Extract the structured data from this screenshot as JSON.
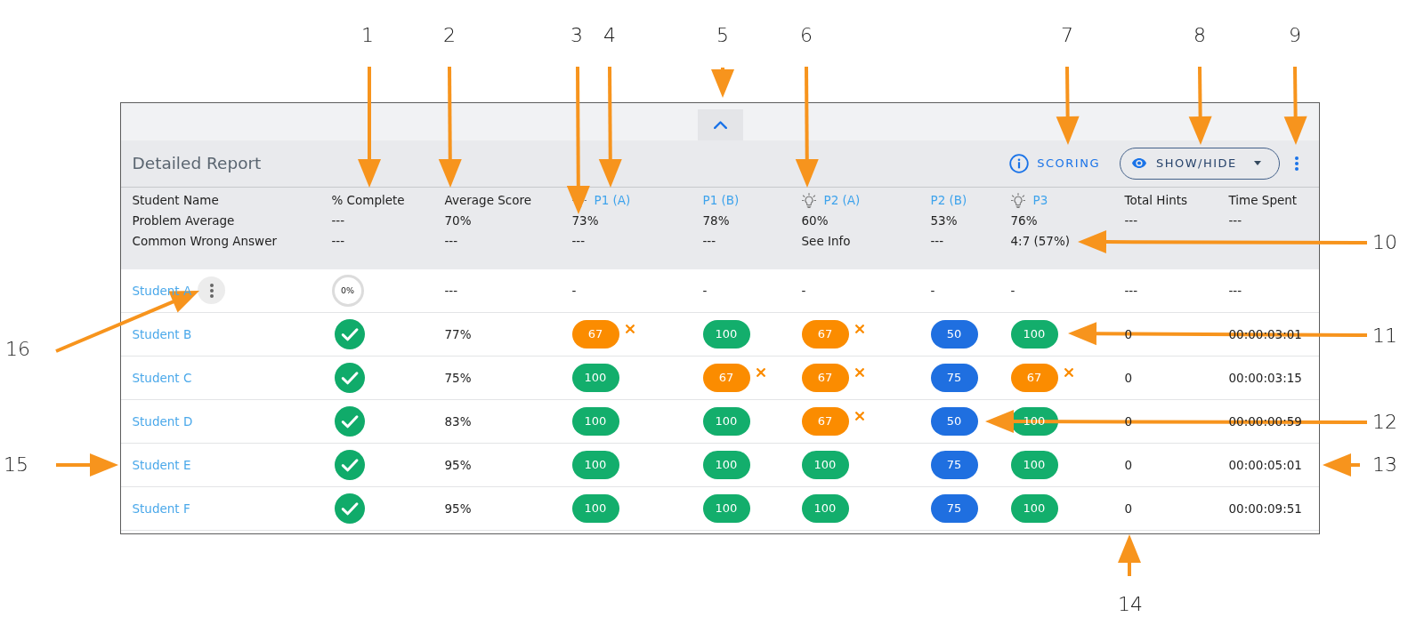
{
  "callouts": [
    "1",
    "2",
    "3",
    "4",
    "5",
    "6",
    "7",
    "8",
    "9",
    "10",
    "11",
    "12",
    "13",
    "14",
    "15",
    "16"
  ],
  "report": {
    "title": "Detailed Report",
    "scoring": "SCORING",
    "show_hide": "SHOW/HIDE"
  },
  "summary": {
    "columns": [
      {
        "kind": "text",
        "heading": "Student Name",
        "average": "Problem Average",
        "wrong_answer": "Common Wrong Answer"
      },
      {
        "kind": "text",
        "heading": "% Complete",
        "average": "---",
        "wrong_answer": "---"
      },
      {
        "kind": "text",
        "heading": "Average Score",
        "average": "70%",
        "wrong_answer": "---"
      },
      {
        "kind": "problem",
        "heading": "P1 (A)",
        "hint": true,
        "average": "73%",
        "wrong_answer": "---"
      },
      {
        "kind": "problem",
        "heading": "P1 (B)",
        "hint": false,
        "average": "78%",
        "wrong_answer": "---"
      },
      {
        "kind": "problem",
        "heading": "P2 (A)",
        "hint": true,
        "average": "60%",
        "wrong_answer": "See Info"
      },
      {
        "kind": "problem",
        "heading": "P2 (B)",
        "hint": false,
        "average": "53%",
        "wrong_answer": "---"
      },
      {
        "kind": "problem",
        "heading": "P3",
        "hint": true,
        "average": "76%",
        "wrong_answer": "4:7 (57%)"
      },
      {
        "kind": "text",
        "heading": "Total Hints",
        "average": "---"
      },
      {
        "kind": "text",
        "heading": "Time Spent",
        "average": "---"
      }
    ]
  },
  "students": [
    {
      "name": "Student A",
      "menu": true,
      "completion": {
        "kind": "ring",
        "text": "0%",
        "level": 0
      },
      "average": "---",
      "scores": [
        {
          "kind": "none",
          "text": "-"
        },
        {
          "kind": "none",
          "text": "-"
        },
        {
          "kind": "none",
          "text": "-"
        },
        {
          "kind": "none",
          "text": "-"
        },
        {
          "kind": "none",
          "text": "-"
        }
      ],
      "hints": "---",
      "time": "---"
    },
    {
      "name": "Student B",
      "menu": false,
      "completion": {
        "kind": "check"
      },
      "average": "77%",
      "scores": [
        {
          "kind": "score",
          "text": "67",
          "color": "#fb8c00",
          "wrong": true
        },
        {
          "kind": "score",
          "text": "100",
          "color": "#13ae6c",
          "wrong": false
        },
        {
          "kind": "score",
          "text": "67",
          "color": "#fb8c00",
          "wrong": true
        },
        {
          "kind": "score",
          "text": "50",
          "color": "#1f6fe0",
          "wrong": false
        },
        {
          "kind": "score",
          "text": "100",
          "color": "#13ae6c",
          "wrong": false
        }
      ],
      "hints": "0",
      "time": "00:00:03:01"
    },
    {
      "name": "Student C",
      "menu": false,
      "completion": {
        "kind": "check"
      },
      "average": "75%",
      "scores": [
        {
          "kind": "score",
          "text": "100",
          "color": "#13ae6c",
          "wrong": false
        },
        {
          "kind": "score",
          "text": "67",
          "color": "#fb8c00",
          "wrong": true
        },
        {
          "kind": "score",
          "text": "67",
          "color": "#fb8c00",
          "wrong": true
        },
        {
          "kind": "score",
          "text": "75",
          "color": "#1f6fe0",
          "wrong": false
        },
        {
          "kind": "score",
          "text": "67",
          "color": "#fb8c00",
          "wrong": true
        }
      ],
      "hints": "0",
      "time": "00:00:03:15"
    },
    {
      "name": "Student D",
      "menu": false,
      "completion": {
        "kind": "check"
      },
      "average": "83%",
      "scores": [
        {
          "kind": "score",
          "text": "100",
          "color": "#13ae6c",
          "wrong": false
        },
        {
          "kind": "score",
          "text": "100",
          "color": "#13ae6c",
          "wrong": false
        },
        {
          "kind": "score",
          "text": "67",
          "color": "#fb8c00",
          "wrong": true
        },
        {
          "kind": "score",
          "text": "50",
          "color": "#1f6fe0",
          "wrong": false
        },
        {
          "kind": "score",
          "text": "100",
          "color": "#13ae6c",
          "wrong": false
        }
      ],
      "hints": "0",
      "time": "00:00:00:59"
    },
    {
      "name": "Student E",
      "menu": false,
      "completion": {
        "kind": "check"
      },
      "average": "95%",
      "scores": [
        {
          "kind": "score",
          "text": "100",
          "color": "#13ae6c",
          "wrong": false
        },
        {
          "kind": "score",
          "text": "100",
          "color": "#13ae6c",
          "wrong": false
        },
        {
          "kind": "score",
          "text": "100",
          "color": "#13ae6c",
          "wrong": false
        },
        {
          "kind": "score",
          "text": "75",
          "color": "#1f6fe0",
          "wrong": false
        },
        {
          "kind": "score",
          "text": "100",
          "color": "#13ae6c",
          "wrong": false
        }
      ],
      "hints": "0",
      "time": "00:00:05:01"
    },
    {
      "name": "Student F",
      "menu": false,
      "completion": {
        "kind": "check"
      },
      "average": "95%",
      "scores": [
        {
          "kind": "score",
          "text": "100",
          "color": "#13ae6c",
          "wrong": false
        },
        {
          "kind": "score",
          "text": "100",
          "color": "#13ae6c",
          "wrong": false
        },
        {
          "kind": "score",
          "text": "100",
          "color": "#13ae6c",
          "wrong": false
        },
        {
          "kind": "score",
          "text": "75",
          "color": "#1f6fe0",
          "wrong": false
        },
        {
          "kind": "score",
          "text": "100",
          "color": "#13ae6c",
          "wrong": false
        }
      ],
      "hints": "0",
      "time": "00:00:09:51"
    }
  ]
}
